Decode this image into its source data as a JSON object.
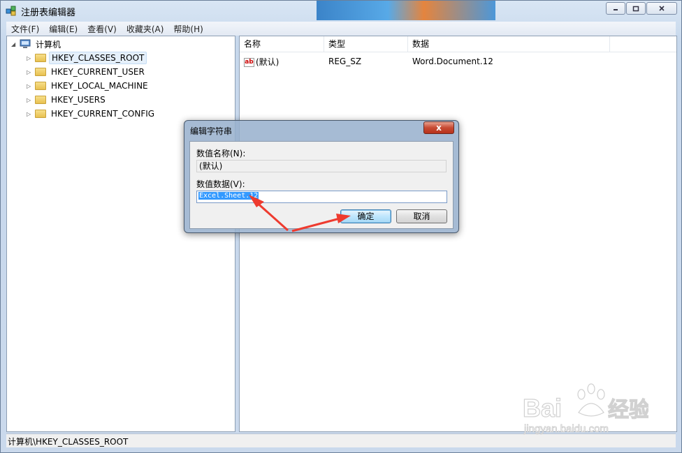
{
  "window": {
    "title": "注册表编辑器"
  },
  "menu": [
    "文件(F)",
    "编辑(E)",
    "查看(V)",
    "收藏夹(A)",
    "帮助(H)"
  ],
  "tree": {
    "root": "计算机",
    "hives": [
      "HKEY_CLASSES_ROOT",
      "HKEY_CURRENT_USER",
      "HKEY_LOCAL_MACHINE",
      "HKEY_USERS",
      "HKEY_CURRENT_CONFIG"
    ]
  },
  "list": {
    "columns": [
      "名称",
      "类型",
      "数据"
    ],
    "rows": [
      {
        "name": "(默认)",
        "type": "REG_SZ",
        "data": "Word.Document.12"
      }
    ]
  },
  "dialog": {
    "title": "编辑字符串",
    "close": "x",
    "value_name_label": "数值名称(N):",
    "value_name": "(默认)",
    "value_data_label": "数值数据(V):",
    "value_data": "Excel.Sheet.12",
    "ok": "确定",
    "cancel": "取消"
  },
  "status": {
    "path": "计算机\\HKEY_CLASSES_ROOT"
  },
  "annotation": {
    "arrow_color": "#ee3b2f"
  },
  "watermark": {
    "brand": "Baidu",
    "brand_cn": "经验",
    "url": "jingyan.baidu.com"
  }
}
